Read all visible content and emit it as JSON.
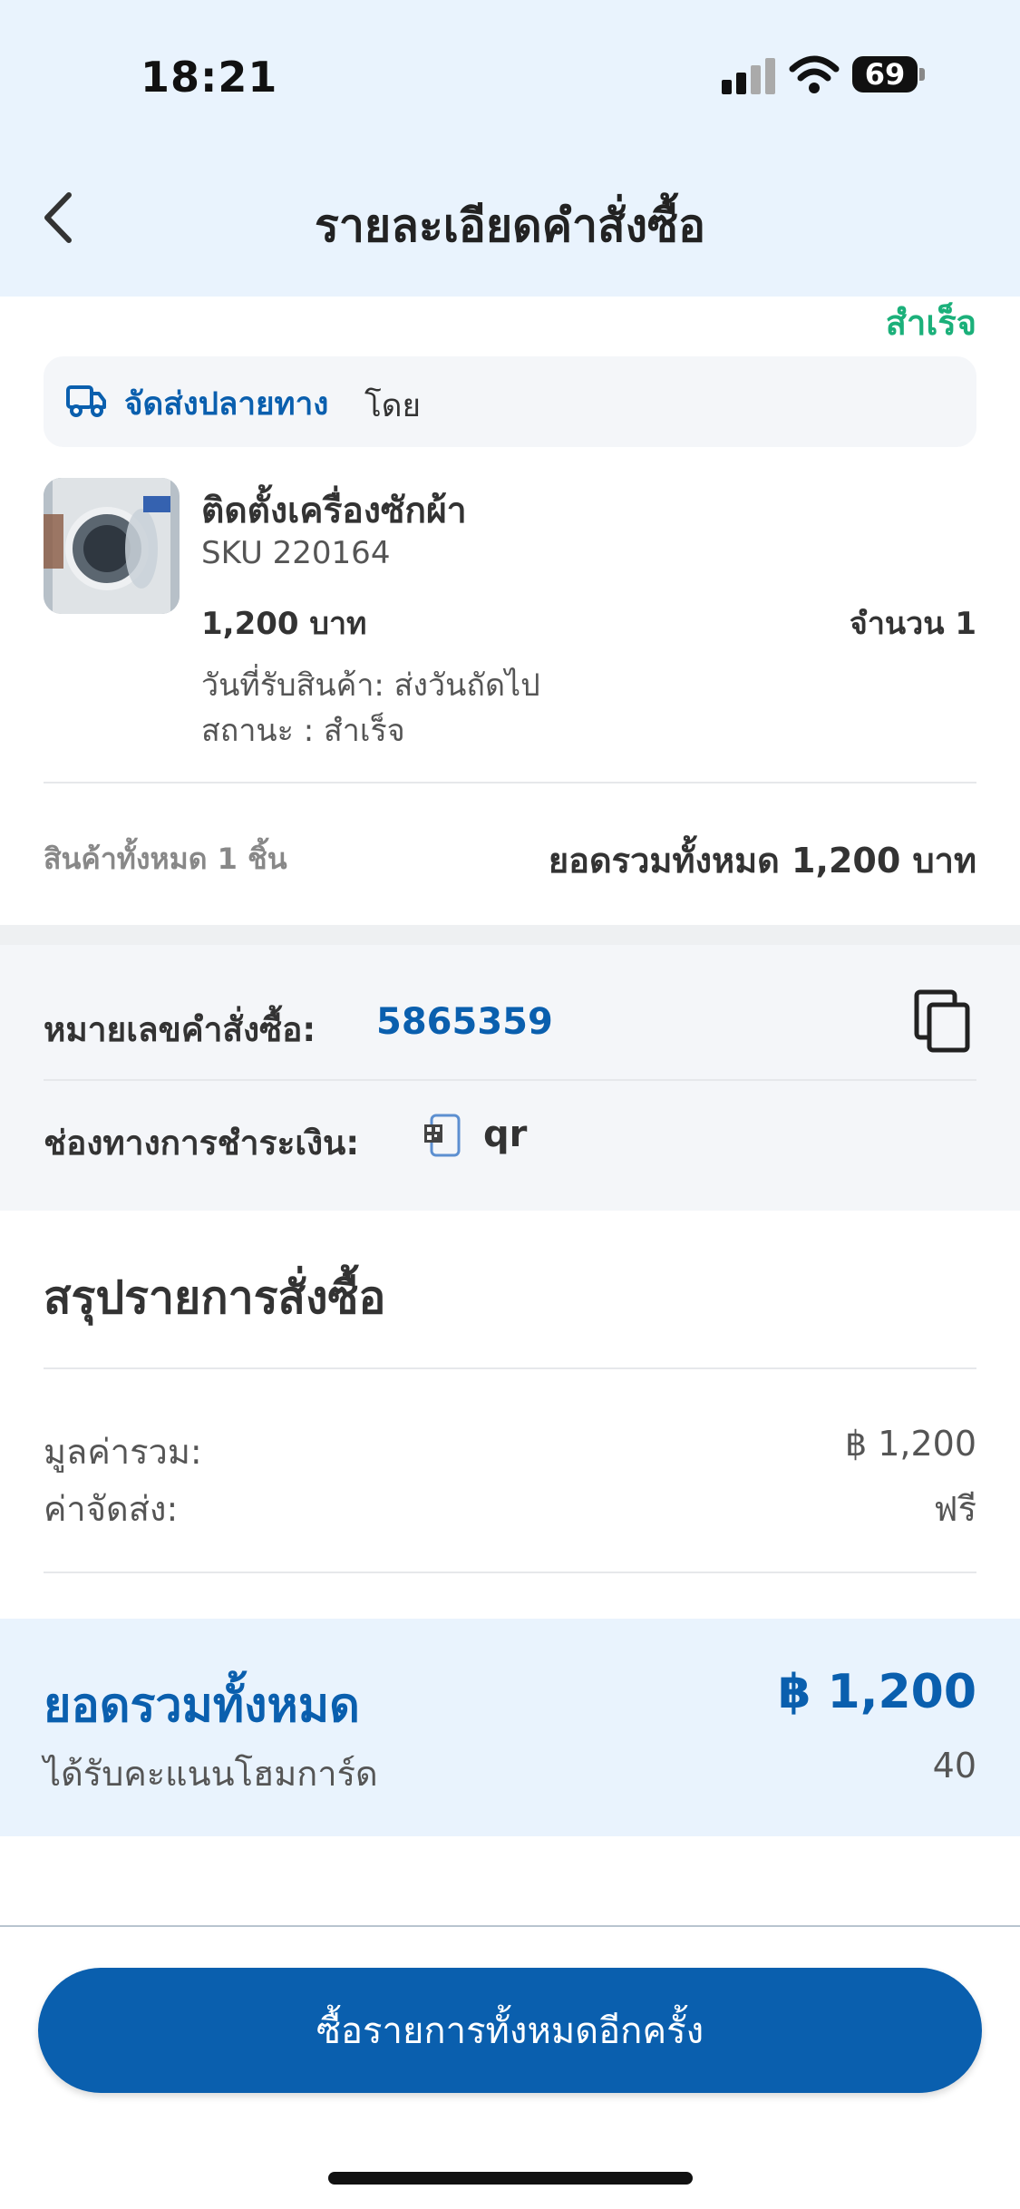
{
  "status_bar": {
    "time": "18:21",
    "battery": "69"
  },
  "header": {
    "title": "รายละเอียดคำสั่งซื้อ"
  },
  "order": {
    "status": "สำเร็จ",
    "delivery_label": "จัดส่งปลายทาง",
    "delivery_by": "โดย",
    "product": {
      "name": "ติดตั้งเครื่องซักผ้า",
      "sku": "SKU 220164",
      "price": "1,200 บาท",
      "quantity": "จำนวน 1",
      "receive_date": "วันที่รับสินค้า: ส่งวันถัดไป",
      "status": "สถานะ : สำเร็จ"
    },
    "items_count": "สินค้าทั้งหมด 1 ชิ้น",
    "items_total": "ยอดรวมทั้งหมด 1,200 บาท"
  },
  "order_info": {
    "order_number_label": "หมายเลขคำสั่งซื้อ:",
    "order_number": "5865359",
    "payment_label": "ช่องทางการชำระเงิน:",
    "payment_method": "qr"
  },
  "summary": {
    "title": "สรุปรายการสั่งซื้อ",
    "subtotal_label": "มูลค่ารวม:",
    "subtotal_value": "฿ 1,200",
    "shipping_label": "ค่าจัดส่ง:",
    "shipping_value": "ฟรี",
    "total_label": "ยอดรวมทั้งหมด",
    "total_value": "฿ 1,200",
    "points_label": "ได้รับคะแนนโฮมการ์ด",
    "points_value": "40"
  },
  "footer": {
    "reorder_label": "ซื้อรายการทั้งหมดอีกครั้ง"
  },
  "colors": {
    "accent": "#0a5fae",
    "success": "#1bb07a",
    "header_bg": "#e9f3fd",
    "panel_bg": "#f4f6f9"
  },
  "icons": [
    "back-icon",
    "truck-icon",
    "copy-icon",
    "qr-icon",
    "signal-icon",
    "wifi-icon",
    "battery-icon"
  ]
}
